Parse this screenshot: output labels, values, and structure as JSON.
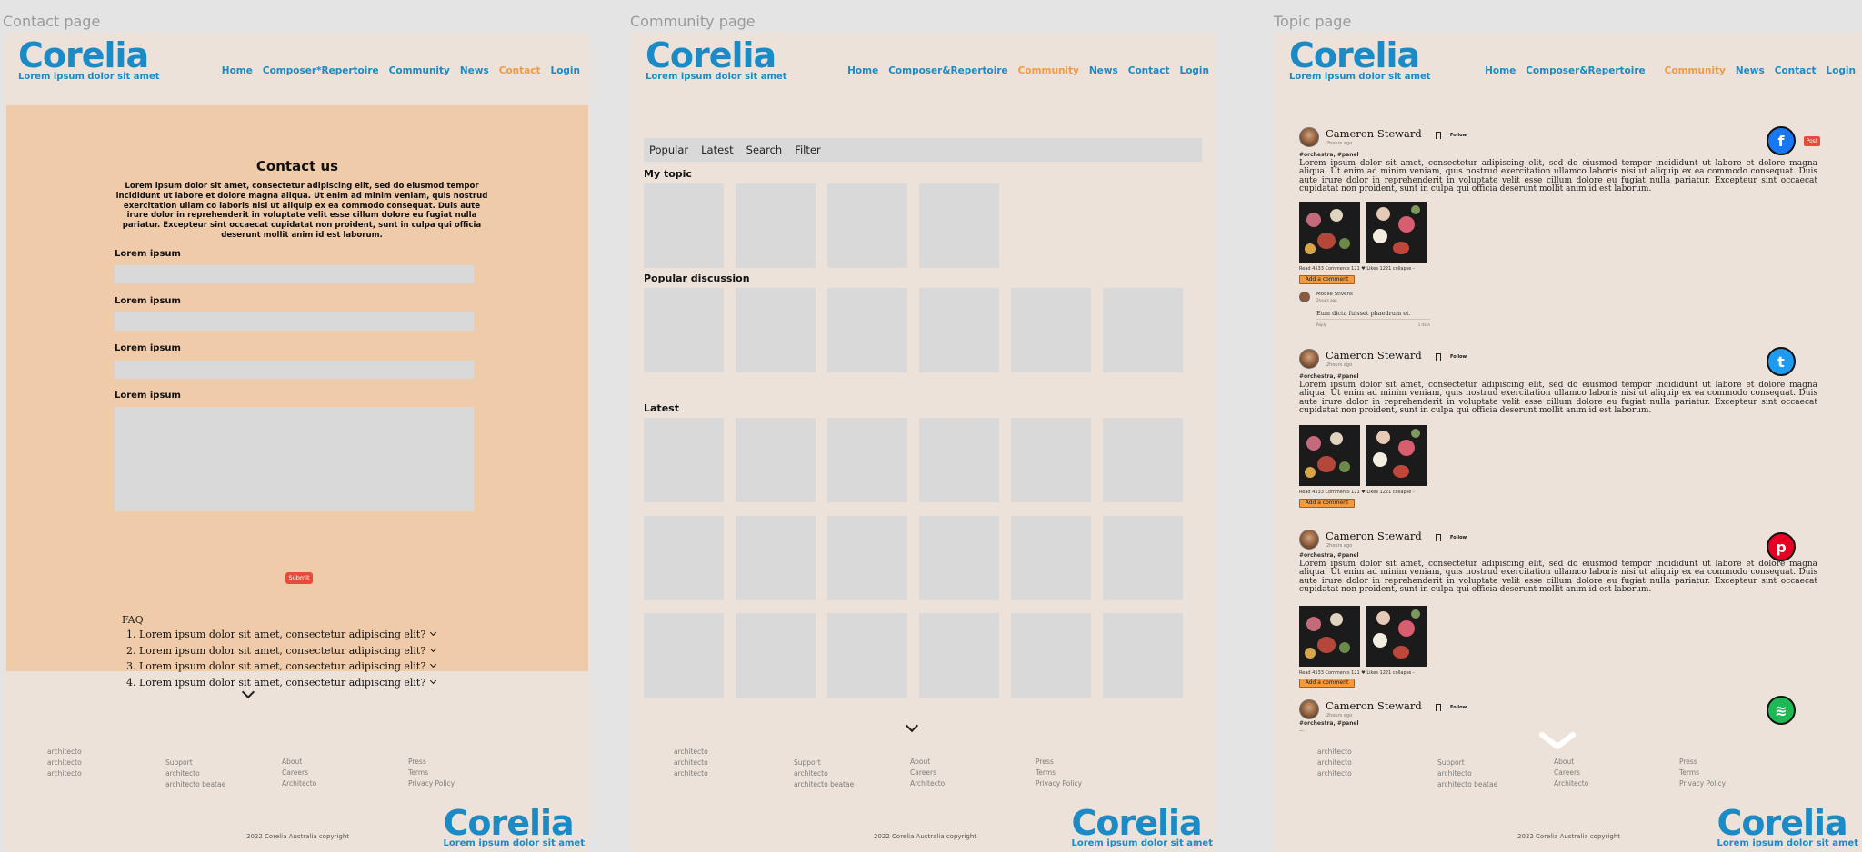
{
  "frames": {
    "contact": {
      "label": "Contact page"
    },
    "community": {
      "label": "Community page"
    },
    "topic": {
      "label": "Topic page"
    }
  },
  "brand": {
    "name": "Corelia",
    "tagline": "Lorem ipsum dolor sit amet"
  },
  "nav_contact": [
    "Home",
    "Composer*Repertoire",
    "Community",
    "News",
    "Contact",
    "Login"
  ],
  "nav_default": [
    "Home",
    "Composer&Repertoire",
    "Community",
    "News",
    "Contact",
    "Login"
  ],
  "contact": {
    "title": "Contact us",
    "intro": "Lorem ipsum dolor sit amet, consectetur adipiscing elit, sed do eiusmod tempor incididunt ut labore et dolore magna aliqua. Ut enim ad minim veniam, quis nostrud exercitation ullam co laboris nisi ut aliquip ex ea commodo consequat. Duis aute irure dolor in reprehenderit in voluptate velit esse cillum dolore eu fugiat nulla pariatur. Excepteur sint occaecat cupidatat non proident, sunt in culpa qui officia deserunt mollit anim id est laborum.",
    "fields": [
      "Lorem ipsum",
      "Lorem ipsum",
      "Lorem ipsum",
      "Lorem ipsum"
    ],
    "submit": "Submit",
    "faq_title": "FAQ",
    "faq": [
      "1. Lorem ipsum dolor sit amet, consectetur adipiscing elit?",
      "2. Lorem ipsum dolor sit amet, consectetur adipiscing elit?",
      "3. Lorem ipsum dolor sit amet, consectetur adipiscing elit?",
      "4. Lorem ipsum dolor sit amet, consectetur adipiscing elit?"
    ]
  },
  "community": {
    "tabs": [
      "Popular",
      "Latest",
      "Search",
      "Filter"
    ],
    "my_topic": "My topic",
    "popular_discussion": "Popular discussion",
    "latest": "Latest"
  },
  "topic": {
    "posts": [
      {
        "user": "Cameron Steward",
        "time": "2hours ago",
        "tags": "#orchestra, #panel",
        "social": "facebook",
        "social_color": "#1877f2"
      },
      {
        "user": "Cameron Steward",
        "time": "2hours ago",
        "tags": "#orchestra, #panel",
        "social": "twitter",
        "social_color": "#1d9bf0"
      },
      {
        "user": "Cameron Steward",
        "time": "2hours ago",
        "tags": "#orchestra, #panel",
        "social": "pinterest",
        "social_color": "#e60023"
      },
      {
        "user": "Cameron Steward",
        "time": "2hours ago",
        "tags": "#orchestra, #panel",
        "social": "spotify",
        "social_color": "#1db954"
      }
    ],
    "follow": "Follow",
    "post_button": "Post",
    "body": "Lorem ipsum dolor sit amet, consectetur adipiscing elit, sed do eiusmod tempor incididunt ut labore et dolore magna aliqua. Ut enim ad minim veniam, quis nostrud exercitation ullamco laboris nisi ut aliquip ex ea commodo consequat. Duis aute irure dolor in reprehenderit in voluptate velit esse cillum dolore eu fugiat nulla pariatur. Excepteur sint occaecat cupidatat non proident, sunt in culpa qui officia deserunt mollit anim id est laborum.",
    "stats": "Read 4533    Comments 121    ♥ Likes 1221    collapse -",
    "add_comment": "Add a comment",
    "comment": {
      "name": "Moolie Stivens",
      "time": "2hours ago",
      "text": "Eum dicta fuisset phaedrum ei.",
      "left": "Reply",
      "right": "1 days"
    },
    "ellipsis": "..."
  },
  "footer": {
    "col1": [
      "architecto",
      "architecto",
      "architecto"
    ],
    "col2": [
      "Support",
      "architecto",
      "architecto beatae"
    ],
    "col3": [
      "About",
      "Careers",
      "Architecto"
    ],
    "col4": [
      "Press",
      "Terms",
      "Privacy Policy"
    ],
    "copyright": "2022 Corelia Australia    copyright"
  },
  "colors": {
    "brand_blue": "#1a8bc6",
    "active_orange": "#f39a3d",
    "contact_panel": "#f0cbaa",
    "frame_bg": "#ece2d9",
    "submit_red": "#e84b3c"
  }
}
